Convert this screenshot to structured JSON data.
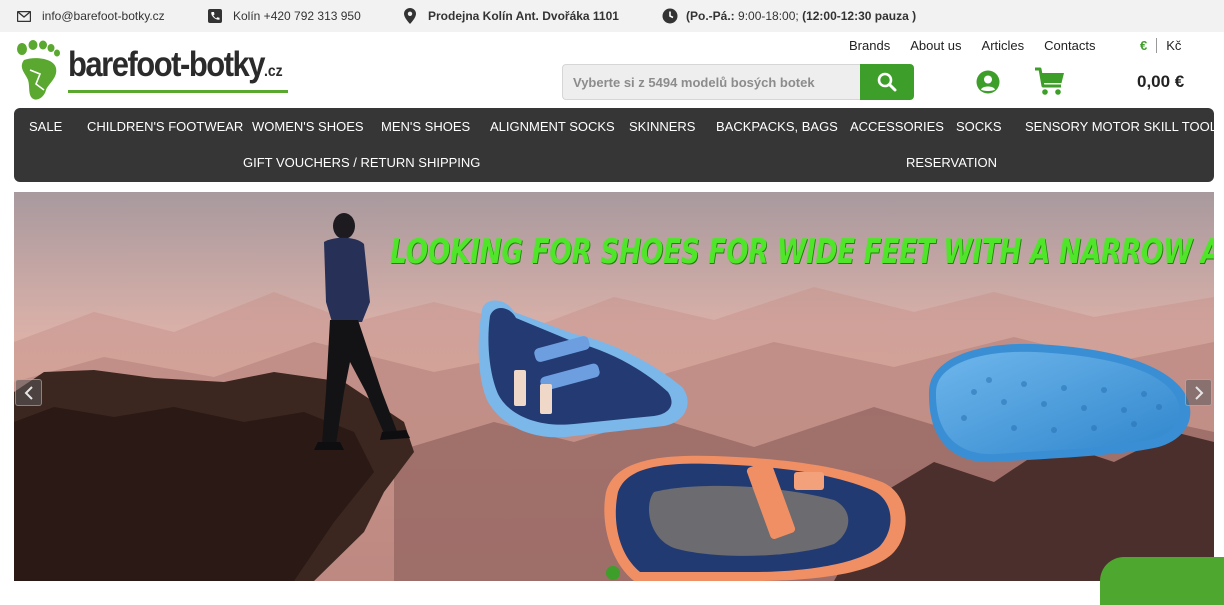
{
  "topbar": {
    "email": "info@barefoot-botky.cz",
    "phone": "Kolín +420 792 313 950",
    "store": "Prodejna Kolín Ant. Dvořáka 1101",
    "hours_prefix": "(Po.-Pá.:",
    "hours_main": "9:00-18:00;",
    "hours_break": "(12:00-12:30 pauza )"
  },
  "logo": {
    "name": "barefoot-botky",
    "tld": ".cz"
  },
  "header_links": [
    "Brands",
    "About us",
    "Articles",
    "Contacts"
  ],
  "currency": {
    "active": "€",
    "other": "Kč"
  },
  "search": {
    "placeholder": "Vyberte si z 5494 modelů bosých botek"
  },
  "cart": {
    "total": "0,00 €"
  },
  "nav": {
    "row1": [
      "SALE",
      "CHILDREN'S FOOTWEAR",
      "WOMEN'S SHOES",
      "MEN'S SHOES",
      "ALIGNMENT SOCKS",
      "SKINNERS",
      "BACKPACKS, BAGS",
      "ACCESSORIES",
      "SOCKS",
      "SENSORY MOTOR SKILL TOOLS"
    ],
    "row2": [
      "GIFT VOUCHERS / RETURN SHIPPING",
      "RESERVATION"
    ]
  },
  "hero": {
    "headline": "LOOKING FOR SHOES FOR WIDE FEET WITH A NARROW ANKLE?"
  },
  "colors": {
    "brand_green": "#3e9e2a",
    "nav_bg": "#363636",
    "headline_green": "#4fe62a"
  },
  "icons": [
    "envelope-icon",
    "phone-icon",
    "map-pin-icon",
    "clock-icon",
    "search-icon",
    "user-icon",
    "cart-icon",
    "chevron-left-icon",
    "chevron-right-icon"
  ]
}
